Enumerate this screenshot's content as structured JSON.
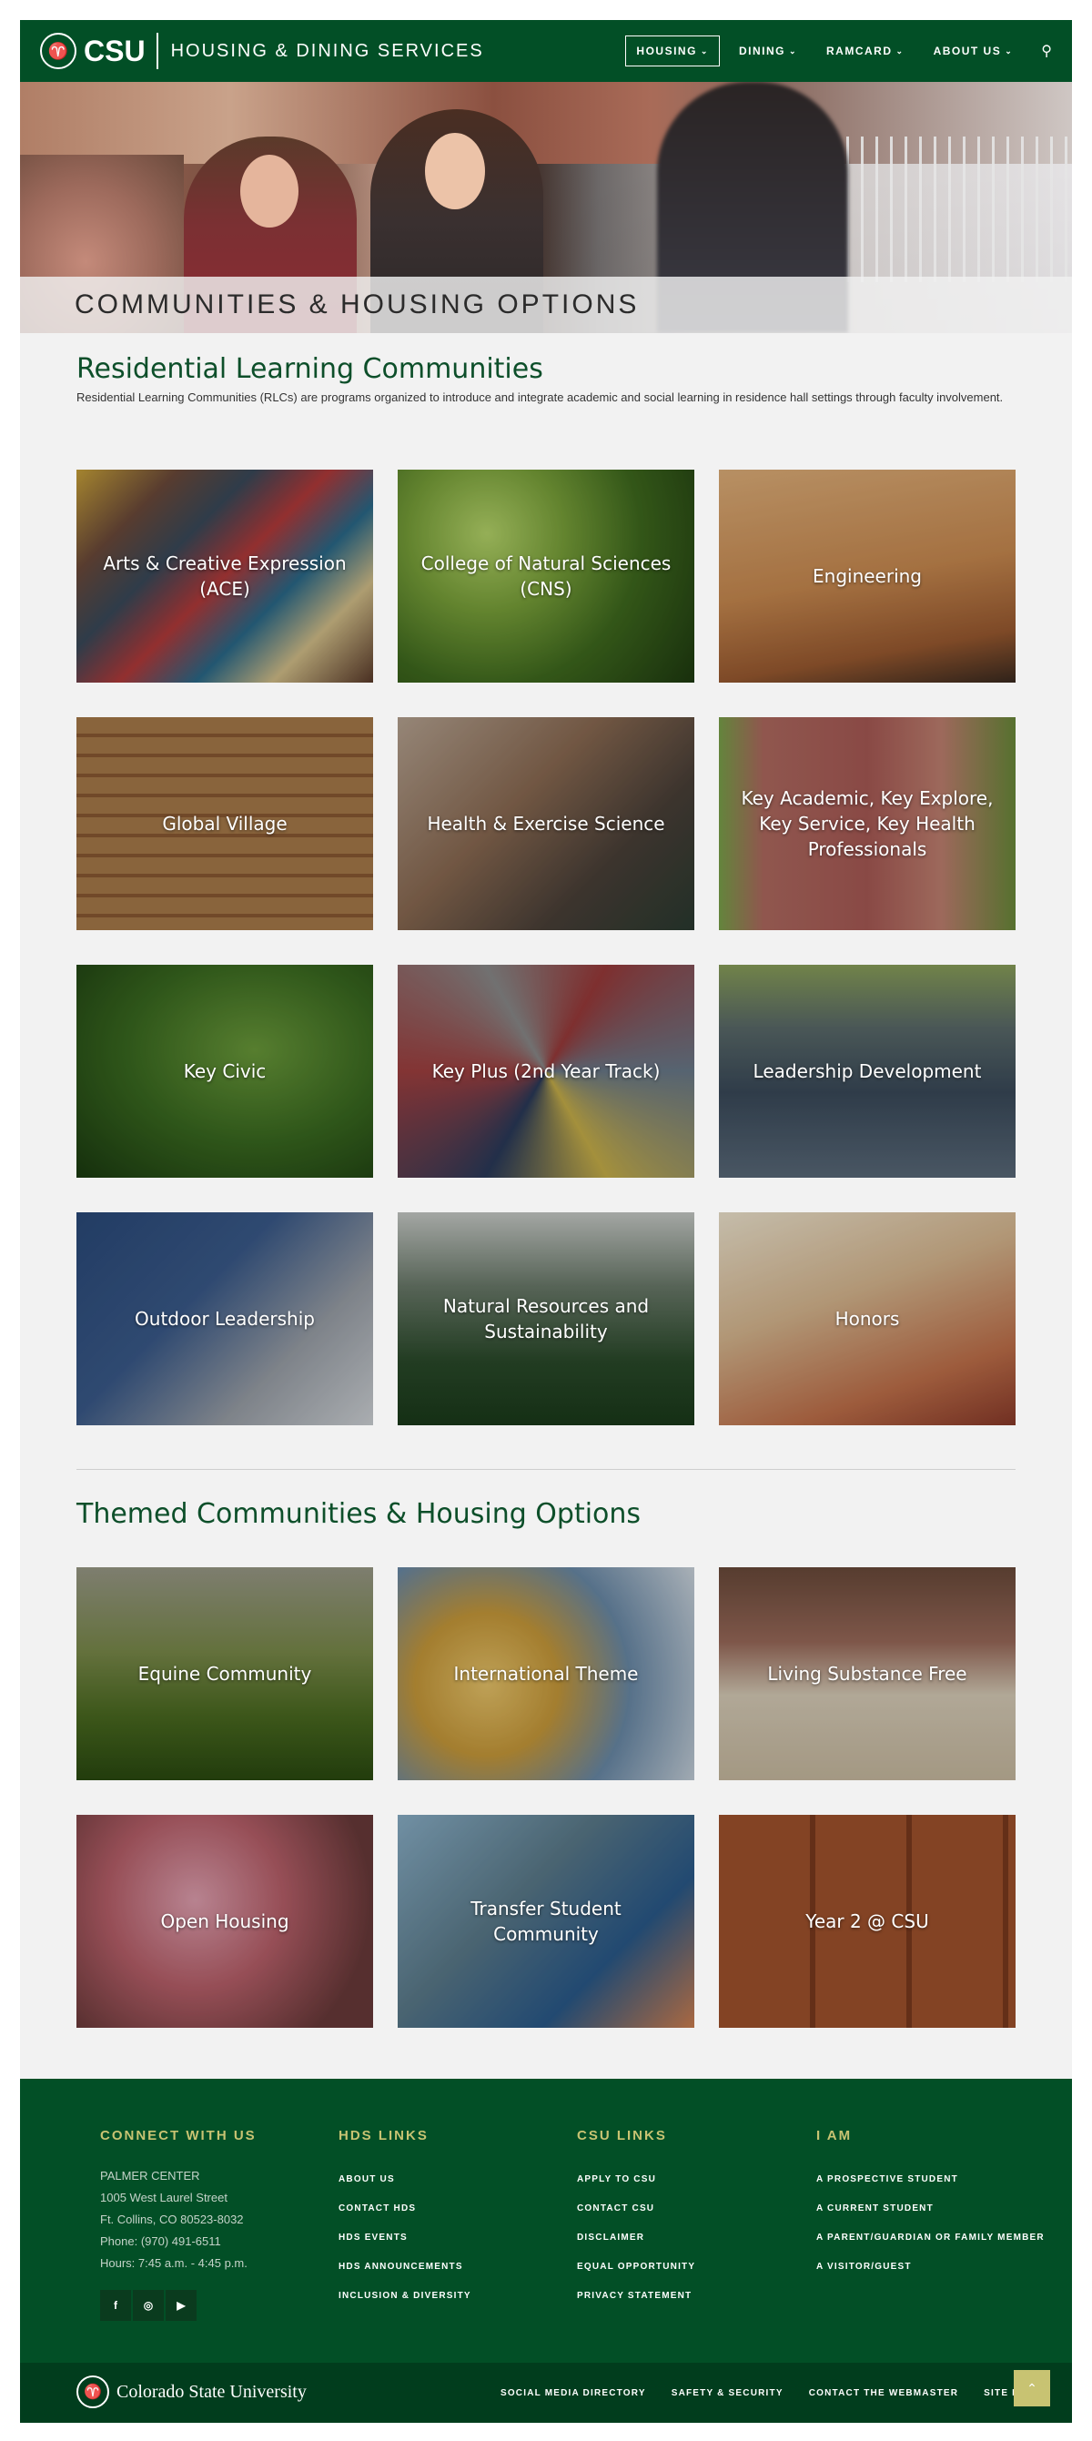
{
  "header": {
    "brand": "CSU",
    "ram_icon": "ram-logo-icon",
    "subtitle": "HOUSING & DINING SERVICES",
    "nav": [
      {
        "label": "HOUSING",
        "active": true
      },
      {
        "label": "DINING",
        "active": false
      },
      {
        "label": "RAMCARD",
        "active": false
      },
      {
        "label": "ABOUT US",
        "active": false
      }
    ],
    "search_icon": "search-icon"
  },
  "hero": {
    "title": "COMMUNITIES & HOUSING OPTIONS"
  },
  "rlc": {
    "title": "Residential Learning Communities",
    "description": "Residential Learning Communities (RLCs) are programs organized to introduce and integrate academic and social learning in residence hall settings through faculty involvement.",
    "tiles": [
      {
        "label": "Arts & Creative Expression (ACE)",
        "bg": "art"
      },
      {
        "label": "College of Natural Sciences (CNS)",
        "bg": "leaves"
      },
      {
        "label": "Engineering",
        "bg": "wood-ceiling"
      },
      {
        "label": "Global Village",
        "bg": "wood-wall"
      },
      {
        "label": "Health & Exercise Science",
        "bg": "climbing"
      },
      {
        "label": "Key Academic, Key Explore, Key Service, Key Health Professionals",
        "bg": "brick"
      },
      {
        "label": "Key Civic",
        "bg": "bike"
      },
      {
        "label": "Key Plus (2nd Year Track)",
        "bg": "hexagons"
      },
      {
        "label": "Leadership Development",
        "bg": "river"
      },
      {
        "label": "Outdoor Leadership",
        "bg": "climber"
      },
      {
        "label": "Natural Resources and Sustainability",
        "bg": "forest"
      },
      {
        "label": "Honors",
        "bg": "notebook"
      }
    ]
  },
  "themed": {
    "title": "Themed Communities & Housing Options",
    "tiles": [
      {
        "label": "Equine Community",
        "bg": "meadow"
      },
      {
        "label": "International Theme",
        "bg": "globe"
      },
      {
        "label": "Living Substance Free",
        "bg": "photos"
      },
      {
        "label": "Open Housing",
        "bg": "blossom"
      },
      {
        "label": "Transfer Student Community",
        "bg": "students"
      },
      {
        "label": "Year 2 @ CSU",
        "bg": "wood-door"
      }
    ]
  },
  "footer": {
    "connect": {
      "title": "CONNECT WITH US",
      "lines": [
        "PALMER CENTER",
        "1005 West Laurel Street",
        "Ft. Collins, CO 80523-8032",
        "Phone: (970) 491-6511",
        "Hours: 7:45 a.m. - 4:45 p.m."
      ]
    },
    "social": [
      {
        "icon": "facebook-icon",
        "glyph": "f"
      },
      {
        "icon": "instagram-icon",
        "glyph": "◎"
      },
      {
        "icon": "youtube-icon",
        "glyph": "▶"
      }
    ],
    "hds_links": {
      "title": "HDS LINKS",
      "items": [
        "ABOUT US",
        "CONTACT HDS",
        "HDS EVENTS",
        "HDS ANNOUNCEMENTS",
        "INCLUSION & DIVERSITY"
      ]
    },
    "csu_links": {
      "title": "CSU LINKS",
      "items": [
        "APPLY TO CSU",
        "CONTACT CSU",
        "DISCLAIMER",
        "EQUAL OPPORTUNITY",
        "PRIVACY STATEMENT"
      ]
    },
    "i_am": {
      "title": "I AM",
      "items": [
        "A PROSPECTIVE STUDENT",
        "A CURRENT STUDENT",
        "A PARENT/GUARDIAN OR FAMILY MEMBER",
        "A VISITOR/GUEST"
      ]
    },
    "bottom": {
      "university": "Colorado State University",
      "links": [
        "SOCIAL MEDIA DIRECTORY",
        "SAFETY & SECURITY",
        "CONTACT THE WEBMASTER",
        "SITE MAP"
      ],
      "to_top_icon": "chevron-up-icon"
    }
  },
  "colors": {
    "brand_green": "#024f26",
    "gold": "#c8c372",
    "title_green": "#0d4f2a"
  }
}
